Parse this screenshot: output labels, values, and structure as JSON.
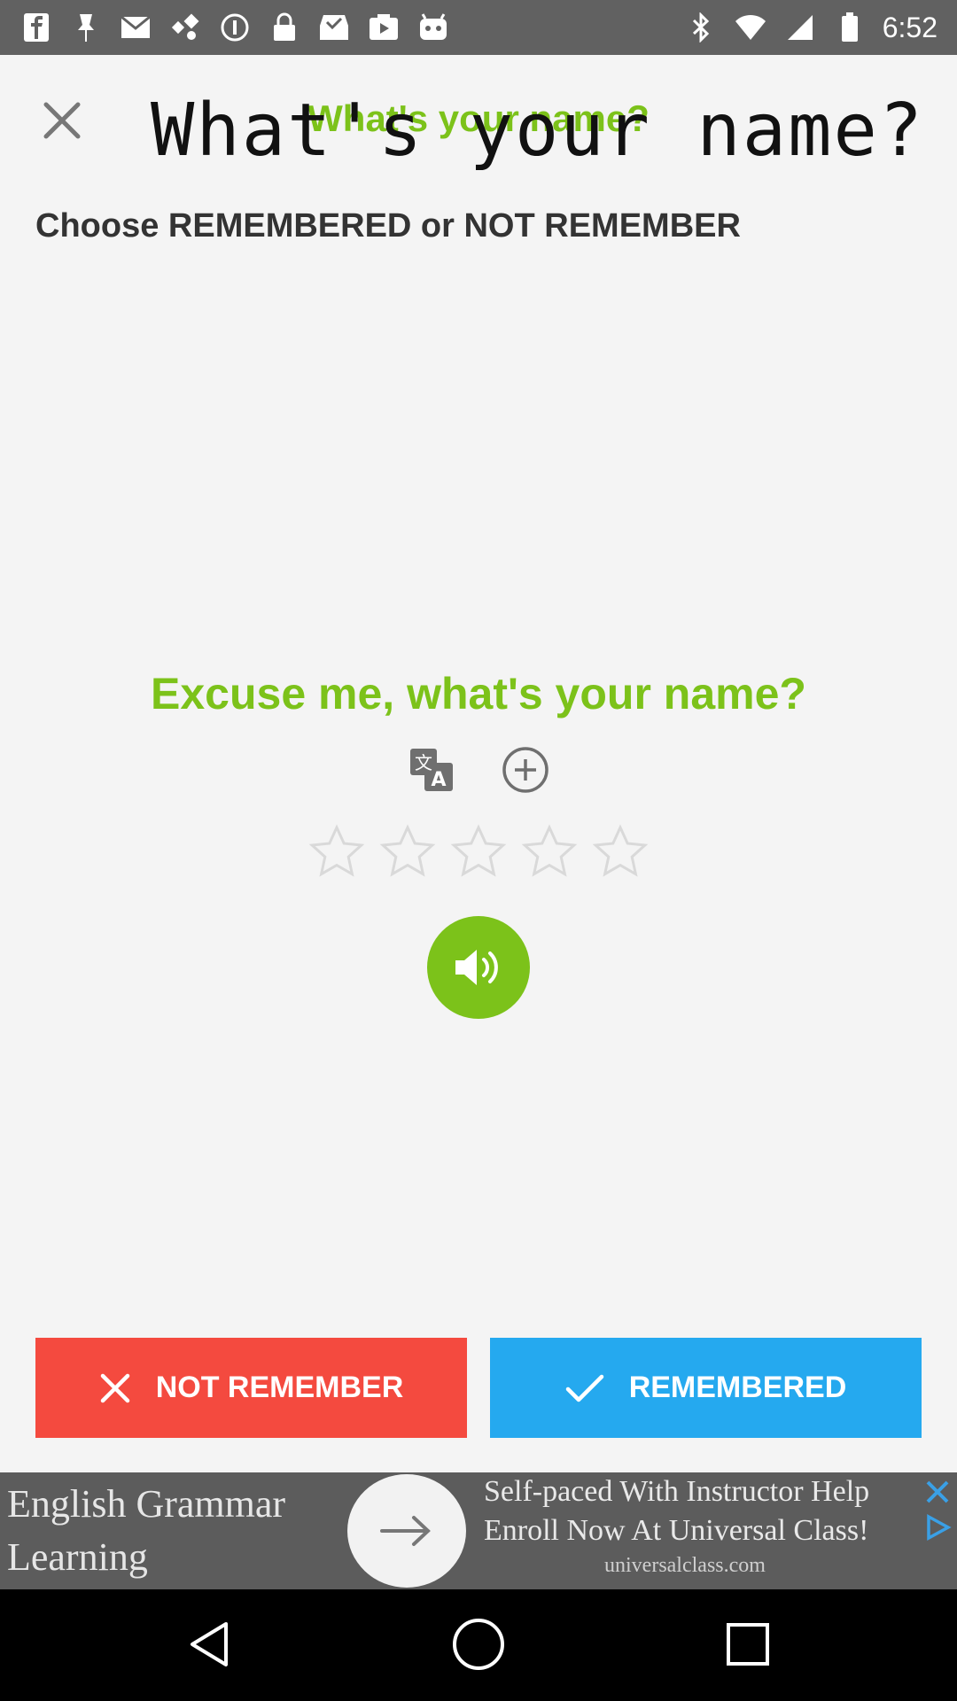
{
  "status_bar": {
    "time": "6:52",
    "left_icons": [
      "facebook-icon",
      "pin-icon",
      "mail-icon",
      "satellite-icon",
      "alert-icon",
      "lock-icon",
      "inbox-icon",
      "play-icon",
      "android-icon"
    ],
    "right_icons": [
      "bluetooth-icon"
    ]
  },
  "header": {
    "title_small": "What's your name?",
    "title_large": "What's your name?"
  },
  "instructions": "Choose REMEMBERED or NOT REMEMBER",
  "phrase": {
    "text": "Excuse me, what's your name?",
    "color": "#7cc21a"
  },
  "rating": {
    "max": 5,
    "value": 0
  },
  "buttons": {
    "not_remember": "NOT REMEMBER",
    "remembered": "REMEMBERED"
  },
  "colors": {
    "accent_green": "#7cc21a",
    "not_remember_red": "#f44a3f",
    "remembered_blue": "#25a9ef"
  },
  "ad": {
    "left_text_line1": "English Grammar",
    "left_text_line2": "Learning",
    "right_text_line1": "Self-paced With Instructor Help",
    "right_text_line2": "Enroll Now At Universal Class!",
    "domain": "universalclass.com"
  }
}
